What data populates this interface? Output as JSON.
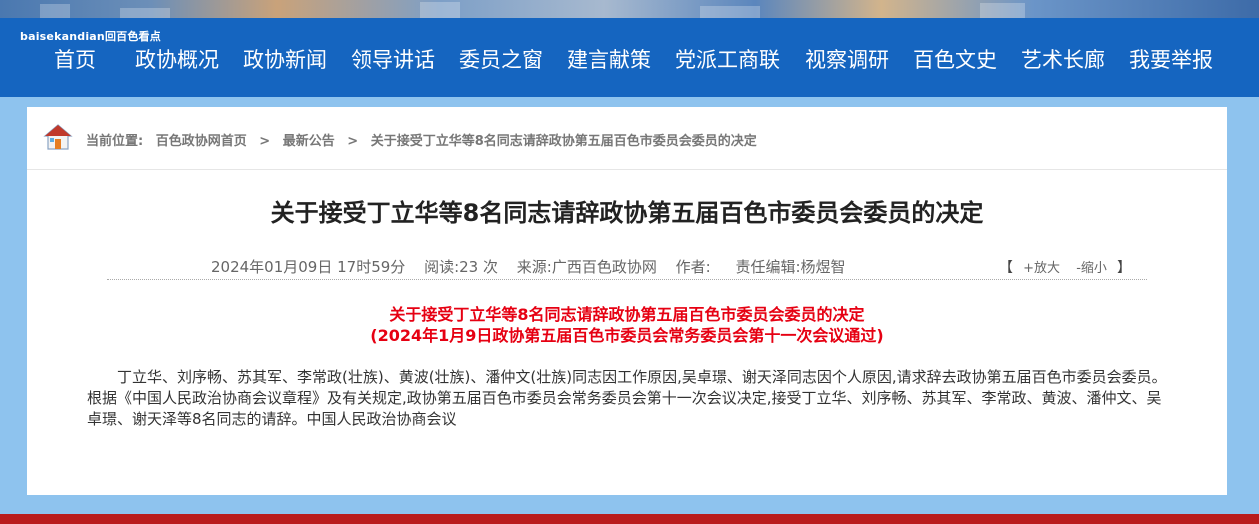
{
  "site": {
    "mark": "baisekandian回百色看点"
  },
  "nav": [
    "首页",
    "政协概况",
    "政协新闻",
    "领导讲话",
    "委员之窗",
    "建言献策",
    "党派工商联",
    "视察调研",
    "百色文史",
    "艺术长廊",
    "我要举报"
  ],
  "breadcrumb": {
    "label": "当前位置:",
    "items": [
      "百色政协网首页",
      "最新公告",
      "关于接受丁立华等8名同志请辞政协第五届百色市委员会委员的决定"
    ],
    "separator": ">"
  },
  "article": {
    "title": "关于接受丁立华等8名同志请辞政协第五届百色市委员会委员的决定",
    "meta": {
      "datetime": "2024年01月09日 17时59分",
      "reads": "阅读:23 次",
      "source": "来源:广西百色政协网",
      "author": "作者:",
      "editor": "责任编辑:杨煜智"
    },
    "zoom": {
      "open": "【",
      "bigger": "+放大",
      "smaller": "-缩小",
      "close": "】"
    },
    "heading1": "关于接受丁立华等8名同志请辞政协第五届百色市委员会委员的决定",
    "heading2": "(2024年1月9日政协第五届百色市委员会常务委员会第十一次会议通过)",
    "body": "丁立华、刘序畅、苏其军、李常政(壮族)、黄波(壮族)、潘仲文(壮族)同志因工作原因,吴卓璟、谢天泽同志因个人原因,请求辞去政协第五届百色市委员会委员。根据《中国人民政治协商会议章程》及有关规定,政协第五届百色市委员会常务委员会第十一次会议决定,接受丁立华、刘序畅、苏其军、李常政、黄波、潘仲文、吴卓璟、谢天泽等8名同志的请辞。中国人民政治协商会议"
  },
  "colors": {
    "nav_bg": "#1565c0",
    "page_bg": "#8ec3ee",
    "red": "#e60012",
    "footer_bar": "#b91c1c"
  }
}
